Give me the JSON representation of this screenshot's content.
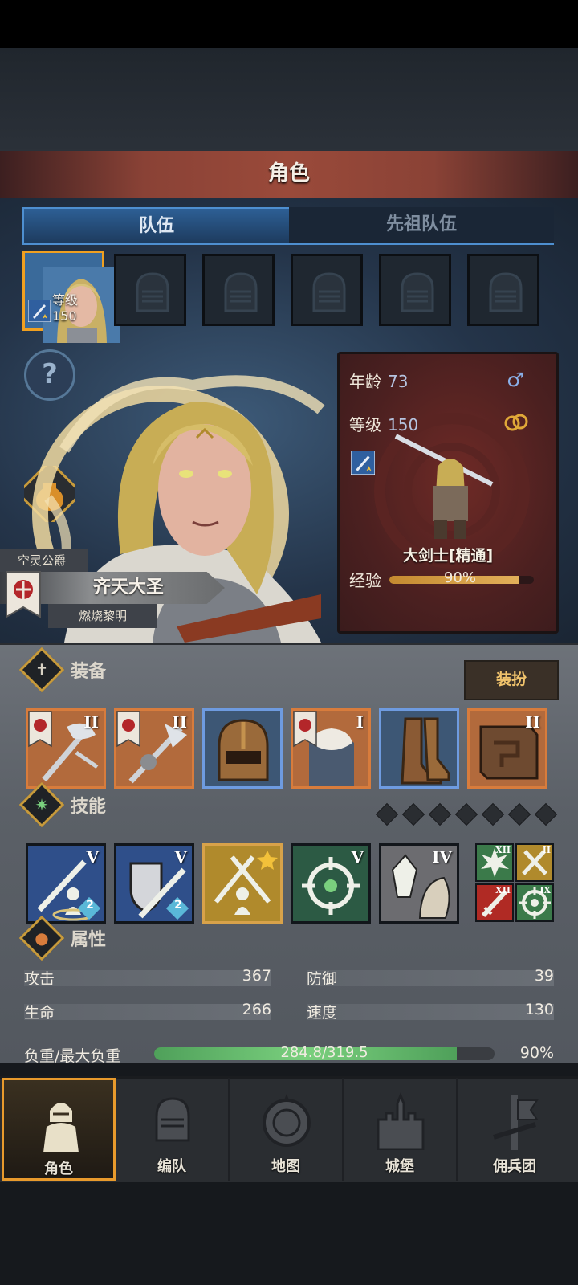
{
  "header": {
    "title": "角色"
  },
  "tabs": [
    {
      "label": "队伍",
      "active": true
    },
    {
      "label": "先祖队伍",
      "active": false
    }
  ],
  "party": {
    "hero_level_label": "等级150"
  },
  "character": {
    "title": "空灵公爵",
    "name": "齐天大圣",
    "guild": "燃烧黎明"
  },
  "info_card": {
    "age_label": "年龄",
    "age_value": "73",
    "level_label": "等级",
    "level_value": "150",
    "class_name": "大剑士[精通]",
    "exp_label": "经验",
    "exp_percent_text": "90%",
    "exp_fraction": 0.9
  },
  "equipment": {
    "title": "装备",
    "dress_button": "装扮",
    "items": [
      {
        "name": "halberd",
        "tier": "II",
        "style": "orange",
        "banner": true
      },
      {
        "name": "polearm",
        "tier": "II",
        "style": "orange",
        "banner": true
      },
      {
        "name": "helmet",
        "tier": "",
        "style": "blue",
        "banner": false
      },
      {
        "name": "fur-armor",
        "tier": "I",
        "style": "orange",
        "banner": true
      },
      {
        "name": "boots",
        "tier": "",
        "style": "blue",
        "banner": false
      },
      {
        "name": "tome",
        "tier": "II",
        "style": "orange",
        "banner": false
      }
    ]
  },
  "skills": {
    "title": "技能",
    "slots": [
      {
        "name": "sword-stance",
        "tier": "V",
        "badge": "2"
      },
      {
        "name": "shield-sword",
        "tier": "V",
        "badge": "2"
      },
      {
        "name": "dual-sword-stance",
        "tier": "",
        "badge": ""
      },
      {
        "name": "crosshair-star",
        "tier": "V",
        "badge": ""
      },
      {
        "name": "crystal-shield",
        "tier": "IV",
        "badge": ""
      }
    ],
    "small_slots": [
      {
        "name": "burst",
        "tier": "XII"
      },
      {
        "name": "cross-swords",
        "tier": "II"
      },
      {
        "name": "red-sword",
        "tier": "XII"
      },
      {
        "name": "target",
        "tier": "IX"
      }
    ]
  },
  "attributes": {
    "title": "属性",
    "attack_label": "攻击",
    "attack_value": "367",
    "defense_label": "防御",
    "defense_value": "39",
    "hp_label": "生命",
    "hp_value": "266",
    "speed_label": "速度",
    "speed_value": "130",
    "load_label": "负重/最大负重",
    "load_text": "284.8/319.5",
    "load_percent": "90%",
    "load_fraction": 0.89
  },
  "nav": {
    "items": [
      {
        "label": "角色",
        "active": true
      },
      {
        "label": "编队",
        "active": false
      },
      {
        "label": "地图",
        "active": false
      },
      {
        "label": "城堡",
        "active": false
      },
      {
        "label": "佣兵团",
        "active": false
      }
    ]
  },
  "colors": {
    "accent_orange": "#d87c3c",
    "accent_blue": "#4e8fd0",
    "exp_bar": "#e2b05a",
    "load_bar": "#7ad07e"
  }
}
